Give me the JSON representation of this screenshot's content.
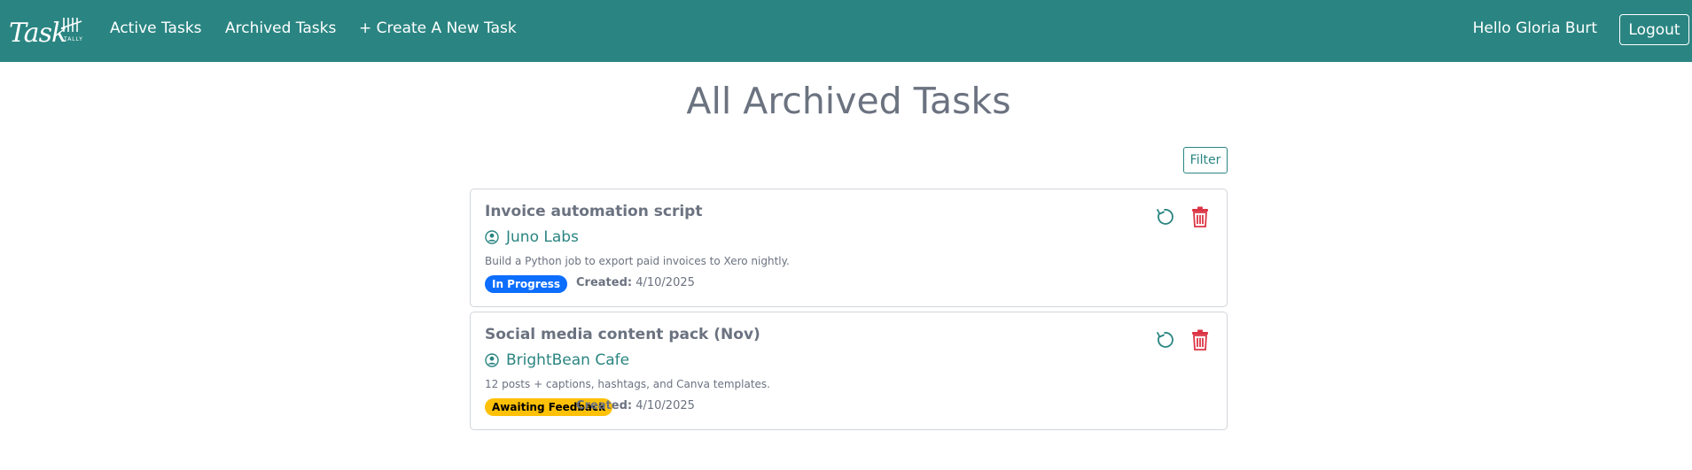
{
  "navbar": {
    "logo": {
      "word": "Task",
      "marks": "̸̸̸̸",
      "sub": "TALLY"
    },
    "links": [
      {
        "label": "Active Tasks"
      },
      {
        "label": "Archived Tasks"
      },
      {
        "label": "+ Create A New Task"
      }
    ],
    "greeting": "Hello Gloria Burt",
    "logout_label": "Logout"
  },
  "page": {
    "title": "All Archived Tasks",
    "filter_label": "Filter"
  },
  "tasks": [
    {
      "title": "Invoice automation script",
      "client": "Juno Labs",
      "description": "Build a Python job to export paid invoices to Xero nightly.",
      "status": "In Progress",
      "created_label": "Created:",
      "created_date": "4/10/2025",
      "restore_icon": "restore-icon",
      "delete_icon": "trash-icon"
    },
    {
      "title": "Social media content pack (Nov)",
      "client": "BrightBean Cafe",
      "description": "12 posts + captions, hashtags, and Canva templates.",
      "status": "Awaiting Feedback",
      "created_label": "Created:",
      "created_date": "4/10/2025",
      "restore_icon": "restore-icon",
      "delete_icon": "trash-icon"
    }
  ],
  "colors": {
    "brand": "#2a8582",
    "danger": "#dc3545",
    "status_in_progress": "#0d6efd",
    "status_awaiting": "#ffc107"
  }
}
